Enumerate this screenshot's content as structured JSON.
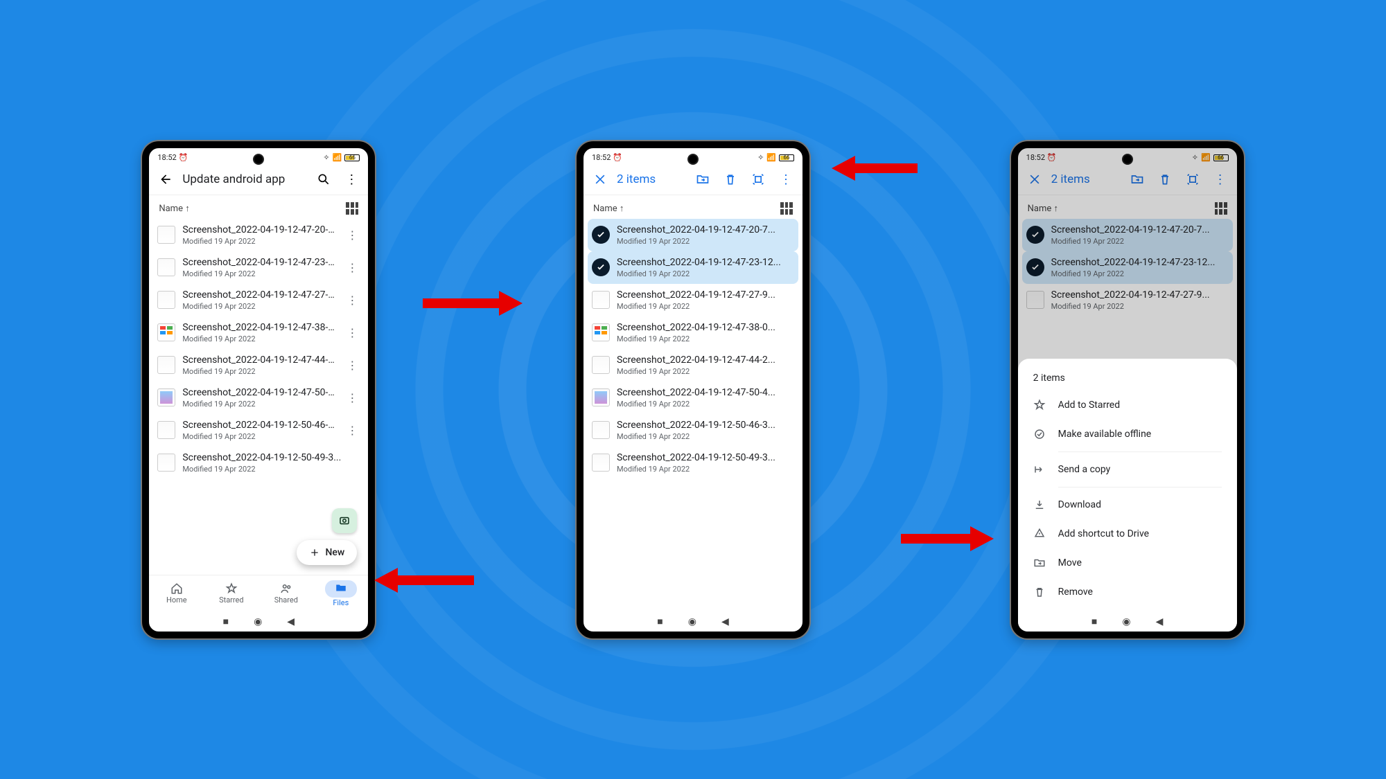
{
  "status": {
    "time": "18:52",
    "battery": "66"
  },
  "phone1": {
    "title": "Update android app",
    "sort": "Name",
    "fab_label": "New",
    "nav": {
      "home": "Home",
      "starred": "Starred",
      "shared": "Shared",
      "files": "Files"
    }
  },
  "selection": {
    "count_label": "2 items"
  },
  "files": [
    {
      "name": "Screenshot_2022-04-19-12-47-20-7...",
      "sub": "Modified 19 Apr 2022",
      "thumb": "plain"
    },
    {
      "name": "Screenshot_2022-04-19-12-47-23-12...",
      "sub": "Modified 19 Apr 2022",
      "thumb": "plain"
    },
    {
      "name": "Screenshot_2022-04-19-12-47-27-9...",
      "sub": "Modified 19 Apr 2022",
      "thumb": "plain"
    },
    {
      "name": "Screenshot_2022-04-19-12-47-38-0...",
      "sub": "Modified 19 Apr 2022",
      "thumb": "color"
    },
    {
      "name": "Screenshot_2022-04-19-12-47-44-2...",
      "sub": "Modified 19 Apr 2022",
      "thumb": "plain"
    },
    {
      "name": "Screenshot_2022-04-19-12-47-50-4...",
      "sub": "Modified 19 Apr 2022",
      "thumb": "app"
    },
    {
      "name": "Screenshot_2022-04-19-12-50-46-3...",
      "sub": "Modified 19 Apr 2022",
      "thumb": "plain"
    },
    {
      "name": "Screenshot_2022-04-19-12-50-49-3...",
      "sub": "Modified 19 Apr 2022",
      "thumb": "plain"
    }
  ],
  "sheet": {
    "title": "2 items",
    "items": {
      "star": "Add to Starred",
      "offline": "Make available offline",
      "send": "Send a copy",
      "download": "Download",
      "shortcut": "Add shortcut to Drive",
      "move": "Move",
      "remove": "Remove"
    }
  }
}
